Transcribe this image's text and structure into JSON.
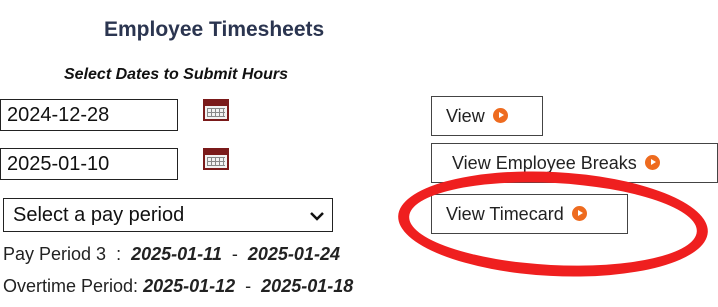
{
  "header": {
    "title": "Employee Timesheets",
    "subtitle": "Select Dates to Submit Hours"
  },
  "dates": {
    "start": "2024-12-28",
    "end": "2025-01-10"
  },
  "pay_period_select": {
    "selected": "Select a pay period"
  },
  "buttons": {
    "view": "View",
    "view_breaks": "View Employee Breaks",
    "view_timecard": "View Timecard"
  },
  "pay_period_info": {
    "label": "Pay Period 3",
    "sep": ":",
    "start": "2025-01-11",
    "dash": "-",
    "end": "2025-01-24"
  },
  "overtime_info": {
    "label": "Overtime Period:",
    "start": "2025-01-12",
    "dash": "-",
    "end": "2025-01-18"
  },
  "colors": {
    "accent_arrow": "#ee6b1f",
    "highlight_circle": "#ef1f1f",
    "title": "#2b3550"
  },
  "icons": [
    "calendar-icon",
    "chevron-down-icon",
    "arrow-right-icon"
  ]
}
